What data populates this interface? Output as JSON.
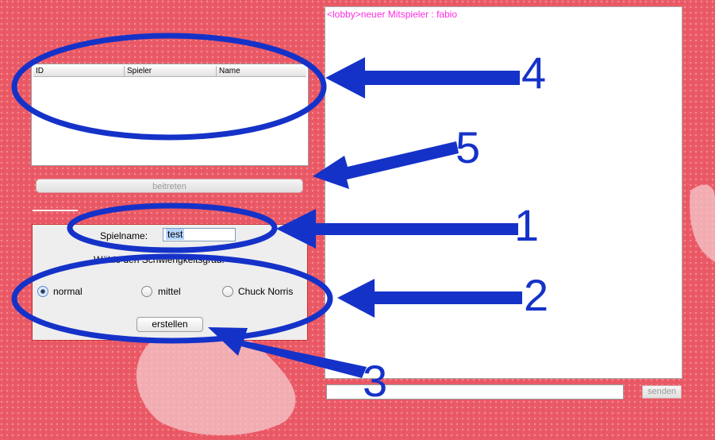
{
  "colors": {
    "background": "#ea5a66",
    "annotation": "#1532c8",
    "chat_text": "#ff2de0"
  },
  "games_table": {
    "columns": [
      "ID",
      "Spieler",
      "Name"
    ],
    "rows": []
  },
  "join_button": "beitreten",
  "create_panel": {
    "game_name_label": "Spielname:",
    "game_name_value": "test",
    "difficulty_label": "Wähle den Schwierigkeitsgrad:",
    "options": [
      "normal",
      "mittel",
      "Chuck Norris"
    ],
    "selected_option": "normal",
    "create_button": "erstellen"
  },
  "chat": {
    "messages": [
      "<lobby>neuer Mitspieler : fabio"
    ],
    "input_value": "",
    "send_button": "senden"
  },
  "annotations": [
    "1",
    "2",
    "3",
    "4",
    "5"
  ]
}
